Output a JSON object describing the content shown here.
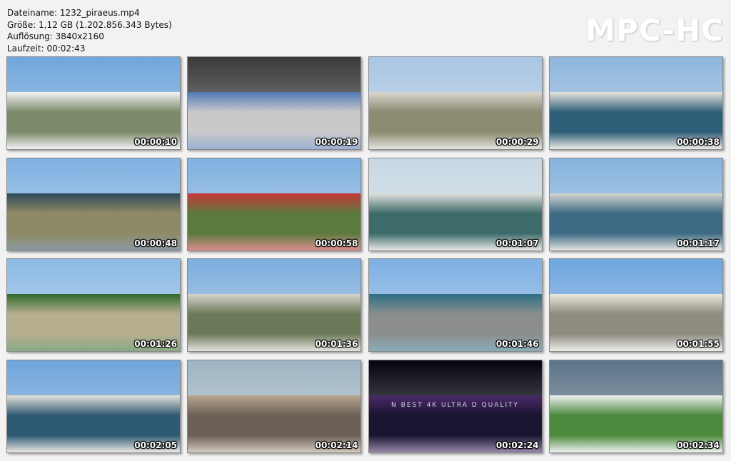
{
  "info": {
    "filename": "Dateiname: 1232_piraeus.mp4",
    "size": "Größe: 1,12 GB (1.202.856.343 Bytes)",
    "resolution": "Auflösung: 3840x2160",
    "duration": "Laufzeit: 00:02:43"
  },
  "logo": "MPC-HC",
  "thumbnails": [
    {
      "time": "00:00:10",
      "sky": "#6fa6dc",
      "ground": "#7c8a6a",
      "accent": "#f4f4f6"
    },
    {
      "time": "00:00:19",
      "sky": "#3a3a3a",
      "ground": "#c9c9c9",
      "accent": "#4f78b8"
    },
    {
      "time": "00:00:29",
      "sky": "#a9c6e4",
      "ground": "#8c8a70",
      "accent": "#d9d7d0"
    },
    {
      "time": "00:00:38",
      "sky": "#8fb6de",
      "ground": "#2f5f78",
      "accent": "#e8e4dc"
    },
    {
      "time": "00:00:48",
      "sky": "#7fb1e2",
      "ground": "#8f8a66",
      "accent": "#2e4a5a"
    },
    {
      "time": "00:00:58",
      "sky": "#80b1e0",
      "ground": "#5b7a3e",
      "accent": "#c8383b"
    },
    {
      "time": "00:01:07",
      "sky": "#c8d8e4",
      "ground": "#3d6b6a",
      "accent": "#e0e0dc"
    },
    {
      "time": "00:01:17",
      "sky": "#86b3dd",
      "ground": "#3e6a84",
      "accent": "#d6d6d2"
    },
    {
      "time": "00:01:26",
      "sky": "#8cbbe6",
      "ground": "#b5ae8f",
      "accent": "#2e6a2a"
    },
    {
      "time": "00:01:36",
      "sky": "#7eaede",
      "ground": "#6c7a5a",
      "accent": "#d8d4cc"
    },
    {
      "time": "00:01:46",
      "sky": "#7fb0e4",
      "ground": "#8b8e8c",
      "accent": "#2d6e88"
    },
    {
      "time": "00:01:55",
      "sky": "#6ea6e0",
      "ground": "#8e8c80",
      "accent": "#ece9e0"
    },
    {
      "time": "00:02:05",
      "sky": "#6fa5dc",
      "ground": "#2f5a74",
      "accent": "#e6e2da"
    },
    {
      "time": "00:02:14",
      "sky": "#9fb5c3",
      "ground": "#6c6158",
      "accent": "#b9a58e"
    },
    {
      "time": "00:02:24",
      "sky": "#050510",
      "ground": "#1a1530",
      "accent": "#4a2a6a",
      "overlay": "N BEST 4K ULTRA  D QUALITY"
    },
    {
      "time": "00:02:34",
      "sky": "#5c7488",
      "ground": "#4b8a3c",
      "accent": "#f0f0f2"
    }
  ]
}
